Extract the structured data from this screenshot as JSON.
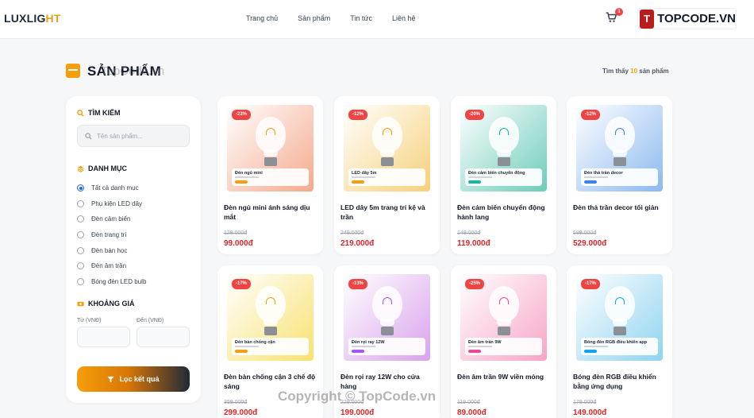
{
  "header": {
    "logo_part1": "LUXLIG",
    "logo_part2": "HT",
    "nav": [
      "Trang chủ",
      "Sản phẩm",
      "Tin tức",
      "Liên hệ"
    ],
    "cart_count": "1",
    "brand_mark": "T",
    "brand_text": "TOPCODE.VN"
  },
  "page": {
    "title": "SẢN PHẨM",
    "result_prefix": "Tìm thấy ",
    "result_count": "10",
    "result_suffix": " sản phẩm",
    "watermark_top": "TopCode.vn",
    "watermark_bottom": "Copyright © TopCode.vn"
  },
  "sidebar": {
    "search_title": "TÌM KIẾM",
    "search_placeholder": "Tên sản phẩm...",
    "category_title": "DANH MỤC",
    "categories": [
      "Tất cả danh mục",
      "Phụ kiện LED dây",
      "Đèn cảm biến",
      "Đèn trang trí",
      "Đèn bàn học",
      "Đèn âm trần",
      "Bóng đèn LED bulb"
    ],
    "selected_category": "Tất cả danh mục",
    "price_title": "KHOẢNG GIÁ",
    "price_from_label": "Từ (VNĐ)",
    "price_to_label": "Đến (VNĐ)",
    "filter_button": "Lọc kết quả"
  },
  "products": [
    {
      "discount": "-23%",
      "name": "Đèn ngủ mini ánh sáng dịu mắt",
      "image_label": "Đèn ngủ mini",
      "old_price": "129.000đ",
      "price": "99.000đ",
      "bg": "#f4a98c",
      "accent": "#f59e0b"
    },
    {
      "discount": "-12%",
      "name": "LED dây 5m trang trí kệ và trần",
      "image_label": "LED dây 5m",
      "old_price": "249.000đ",
      "price": "219.000đ",
      "bg": "#f6d07a",
      "accent": "#f59e0b"
    },
    {
      "discount": "-20%",
      "name": "Đèn cảm biến chuyển động hành lang",
      "image_label": "Đèn cảm biến chuyển động",
      "old_price": "149.000đ",
      "price": "119.000đ",
      "bg": "#6dccb9",
      "accent": "#14b8a6"
    },
    {
      "discount": "-12%",
      "name": "Đèn thả trần decor tối giản",
      "image_label": "Đèn thả trần decor",
      "old_price": "599.000đ",
      "price": "529.000đ",
      "bg": "#8bb9f0",
      "accent": "#3b82f6"
    },
    {
      "discount": "-17%",
      "name": "Đèn bàn chống cận 3 chế độ sáng",
      "image_label": "Đèn bàn chống cận",
      "old_price": "359.000đ",
      "price": "299.000đ",
      "bg": "#f8e16e",
      "accent": "#f59e0b"
    },
    {
      "discount": "-13%",
      "name": "Đèn rọi ray 12W cho cửa hàng",
      "image_label": "Đèn rọi ray 12W",
      "old_price": "229.000đ",
      "price": "199.000đ",
      "bg": "#d9a2ec",
      "accent": "#a855f7"
    },
    {
      "discount": "-25%",
      "name": "Đèn âm trần 9W viền mỏng",
      "image_label": "Đèn âm trần 9W",
      "old_price": "119.000đ",
      "price": "89.000đ",
      "bg": "#f7a5c8",
      "accent": "#ec4899"
    },
    {
      "discount": "-17%",
      "name": "Bóng đèn RGB điều khiển bằng ứng dụng",
      "image_label": "Bóng đèn RGB điều khiển app",
      "old_price": "179.000đ",
      "price": "149.000đ",
      "bg": "#8fd3f0",
      "accent": "#0ea5e9"
    }
  ]
}
